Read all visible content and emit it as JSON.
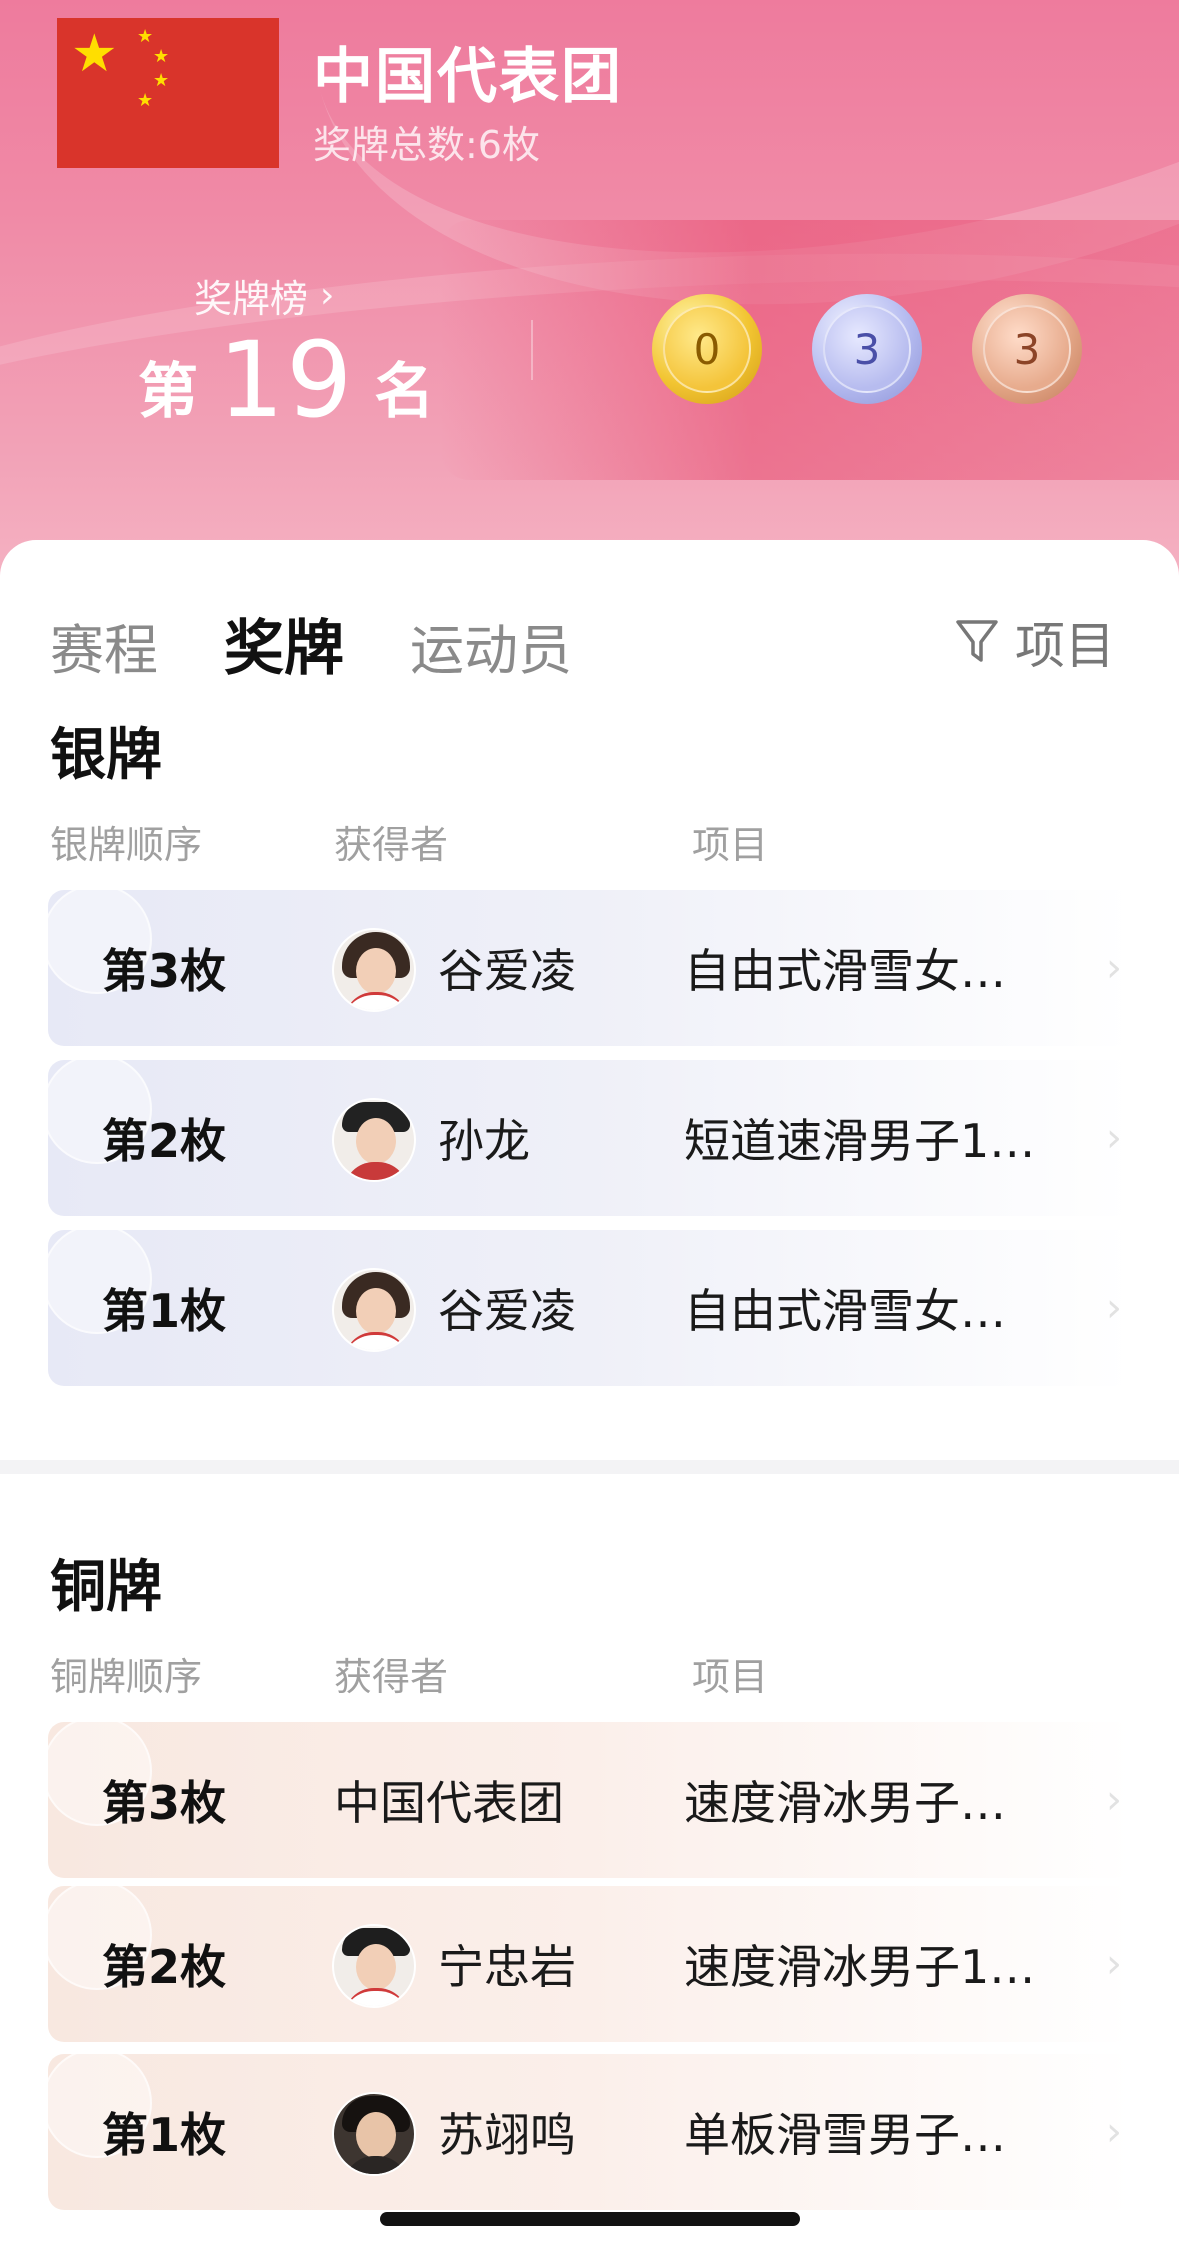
{
  "header": {
    "team_name": "中国代表团",
    "medal_total": "奖牌总数:6枚",
    "rank_link": "奖牌榜",
    "rank_prefix": "第",
    "rank_number": "19",
    "rank_suffix": "名",
    "medals": {
      "gold": "0",
      "silver": "3",
      "bronze": "3"
    },
    "colors": {
      "gold": "#f2c532",
      "silver": "#b5bbf0",
      "bronze": "#e4a788",
      "flag_red": "#d9342b",
      "flag_star": "#ffde00"
    }
  },
  "tabs": [
    {
      "label": "赛程"
    },
    {
      "label": "奖牌",
      "active": true
    },
    {
      "label": "运动员"
    }
  ],
  "filter": {
    "label": "项目",
    "icon": "funnel-icon"
  },
  "silver": {
    "title": "银牌",
    "headers": [
      "银牌顺序",
      "获得者",
      "项目"
    ],
    "rows": [
      {
        "order": "第3枚",
        "winner": "谷爱凌",
        "event": "自由式滑雪女…"
      },
      {
        "order": "第2枚",
        "winner": "孙龙",
        "event": "短道速滑男子1…"
      },
      {
        "order": "第1枚",
        "winner": "谷爱凌",
        "event": "自由式滑雪女…"
      }
    ]
  },
  "bronze": {
    "title": "铜牌",
    "headers": [
      "铜牌顺序",
      "获得者",
      "项目"
    ],
    "rows": [
      {
        "order": "第3枚",
        "winner": "中国代表团",
        "event": "速度滑冰男子…"
      },
      {
        "order": "第2枚",
        "winner": "宁忠岩",
        "event": "速度滑冰男子1…"
      },
      {
        "order": "第1枚",
        "winner": "苏翊鸣",
        "event": "单板滑雪男子…"
      }
    ]
  }
}
